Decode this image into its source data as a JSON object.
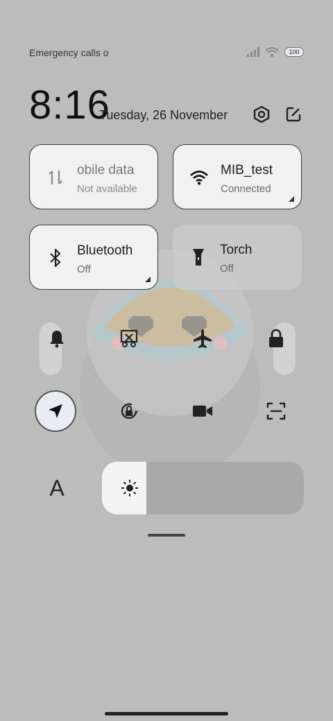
{
  "status_bar": {
    "carrier_text": "Emergency calls o",
    "signal_icon": "signal-bars-icon",
    "wifi_icon": "wifi-icon",
    "battery_level": "100"
  },
  "header": {
    "time": "8:16",
    "date": "Tuesday, 26 November",
    "settings_icon": "settings-hex-icon",
    "edit_icon": "edit-icon"
  },
  "tiles": [
    {
      "id": "mobile-data",
      "title": "obile data",
      "subtitle": "Not available",
      "icon": "mobile-data-icon",
      "state": "disabled"
    },
    {
      "id": "wifi",
      "title": "MIB_test",
      "subtitle": "Connected",
      "icon": "wifi-icon",
      "state": "on"
    },
    {
      "id": "bluetooth",
      "title": "Bluetooth",
      "subtitle": "Off",
      "icon": "bluetooth-icon",
      "state": "on"
    },
    {
      "id": "torch",
      "title": "Torch",
      "subtitle": "Off",
      "icon": "torch-icon",
      "state": "off"
    }
  ],
  "quick_row1": [
    "bell-icon",
    "screenshot-cut-icon",
    "airplane-icon",
    "lock-icon"
  ],
  "quick_row2": [
    "location-icon",
    "rotation-lock-icon",
    "video-camera-icon",
    "scan-icon"
  ],
  "quick_row2_active": "location-icon",
  "brightness": {
    "level": 0.22,
    "icon": "sun-icon"
  },
  "font_button_label": "A"
}
